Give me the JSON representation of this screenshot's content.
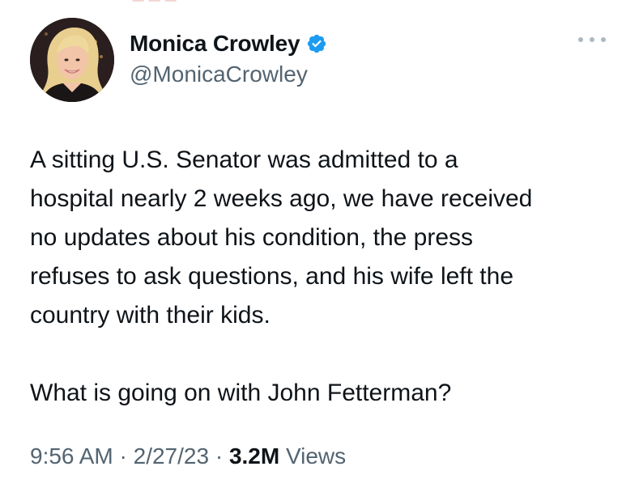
{
  "tweet": {
    "author": {
      "display_name": "Monica Crowley",
      "handle": "@MonicaCrowley",
      "verified": true,
      "verified_color": "#1d9bf0"
    },
    "text_lines": [
      "A sitting U.S. Senator was admitted to a",
      "hospital nearly 2 weeks ago, we have received",
      "no updates about his condition, the press",
      "refuses to ask questions, and his wife left the",
      "country with their kids."
    ],
    "text_line_2": "What is going on with John Fetterman?",
    "meta": {
      "time": "9:56 AM",
      "separator": "·",
      "date": "2/27/23",
      "views_count": "3.2M",
      "views_label": "Views"
    },
    "icons": {
      "avatar": "profile-photo",
      "verified": "verified-badge-icon",
      "more": "more-options-icon"
    }
  }
}
